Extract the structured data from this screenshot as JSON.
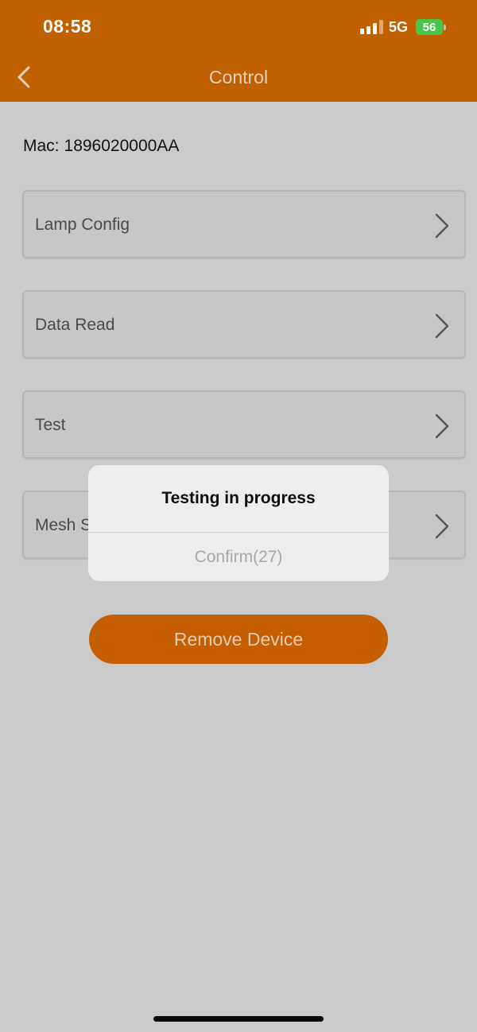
{
  "status_bar": {
    "time": "08:58",
    "network": "5G",
    "battery": "56",
    "battery_color": "#48c64a"
  },
  "header": {
    "title": "Control",
    "back_icon": "chevron-left-icon",
    "background": "#c06000"
  },
  "device": {
    "mac_label": "Mac:",
    "mac_value": "1896020000AA"
  },
  "menu": {
    "items": [
      {
        "label": "Lamp Config",
        "icon": "chevron-right-icon"
      },
      {
        "label": "Data Read",
        "icon": "chevron-right-icon"
      },
      {
        "label": "Test",
        "icon": "chevron-right-icon"
      },
      {
        "label": "Mesh S",
        "icon": "chevron-right-icon"
      }
    ]
  },
  "actions": {
    "remove_label": "Remove Device",
    "accent": "#c45e00"
  },
  "alert": {
    "title": "Testing in progress",
    "button": "Confirm(27)"
  }
}
